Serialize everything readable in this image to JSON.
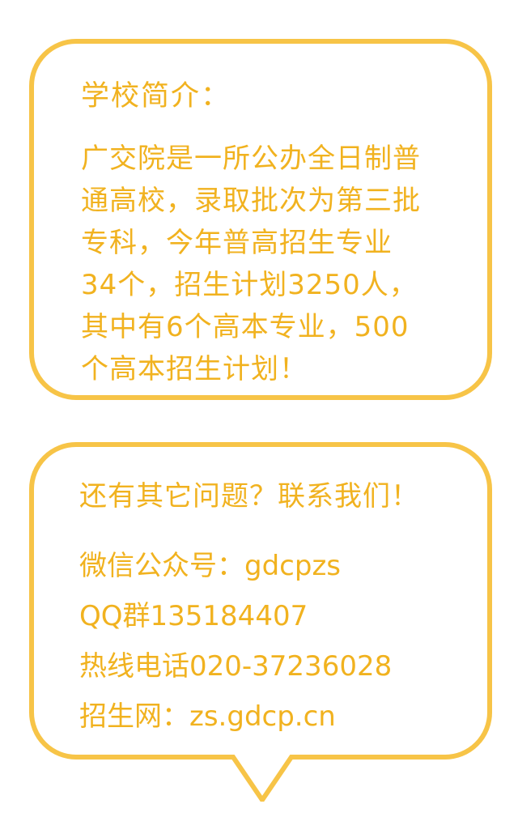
{
  "intro_card": {
    "title": "学校简介：",
    "lines": [
      "广交院是一所公办全日制普",
      "通高校，录取批次为第三批",
      "专科，今年普高招生专业",
      "34个，招生计划3250人，",
      "其中有6个高本专业，500",
      "个高本招生计划！"
    ]
  },
  "contact_card": {
    "title": "还有其它问题？联系我们！",
    "lines": [
      "微信公众号：gdcpzs",
      "QQ群135184407",
      "热线电话020-37236028",
      "招生网：zs.gdcp.cn"
    ]
  },
  "colors": {
    "accent": "#f7c447",
    "text": "#f1b21f",
    "background": "#ffffff"
  }
}
